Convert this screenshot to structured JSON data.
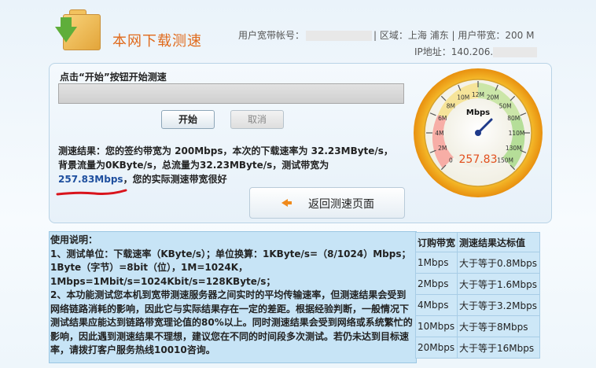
{
  "header": {
    "title": "本网下载测速",
    "account_label": "用户宽带帐号：",
    "region_text": "| 区域：上海 浦东 | 用户带宽：200 M",
    "ip_label": "IP地址：140.206."
  },
  "test": {
    "prompt": "点击“开始”按钮开始测速",
    "progress": 0,
    "start_label": "开始",
    "cancel_label": "取消",
    "back_label": "返回测速页面"
  },
  "result": {
    "line1": "测速结果：您的签约带宽为 200Mbps，本次的下载速率为 32.23MByte/s，",
    "line2": "背景流量为0KByte/s，总流量为32.23MByte/s，测试带宽为",
    "speed": "257.83Mbps",
    "line3": "，您的实际测速带宽很好"
  },
  "gauge": {
    "unit": "Mbps",
    "value_text": "257.83",
    "ticks": [
      "0",
      "2M",
      "4M",
      "6M",
      "8M",
      "10M",
      "12M",
      "20M",
      "50M",
      "80M",
      "110M",
      "130M",
      "150M"
    ]
  },
  "instructions": {
    "heading": "使用说明：",
    "p1": "1、测试单位：下载速率（KByte/s）；单位换算：1KByte/s=（8/1024）Mbps；1Byte（字节）=8bit（位），1M=1024K，1Mbps=1Mbit/s=1024Kbit/s=128KByte/s；",
    "p2": "2、本功能测试您本机到宽带测速服务器之间实时的平均传输速率，但测速结果会受到网络链路消耗的影响，因此它与实际结果存在一定的差距。根据经验判断，一般情况下测试结果应能达到链路带宽理论值的80%以上。同时测速结果会受到网络或系统繁忙的影响，因此遇到测速结果不理想，建议您在不同的时间段多次测试。若仍未达到目标速率，请拨打客户服务热线10010咨询。"
  },
  "rate_table": {
    "headers": [
      "订购带宽",
      "测速结果达标值"
    ],
    "rows": [
      [
        "1Mbps",
        "大于等于0.8Mbps"
      ],
      [
        "2Mbps",
        "大于等于1.6Mbps"
      ],
      [
        "4Mbps",
        "大于等于3.2Mbps"
      ],
      [
        "10Mbps",
        "大于等于8Mbps"
      ],
      [
        "20Mbps",
        "大于等于16Mbps"
      ]
    ]
  },
  "colors": {
    "accent_orange": "#e06a1c",
    "result_blue": "#1e4f9e",
    "underline_red": "#d9141c",
    "needle_value": "#e2501e"
  }
}
